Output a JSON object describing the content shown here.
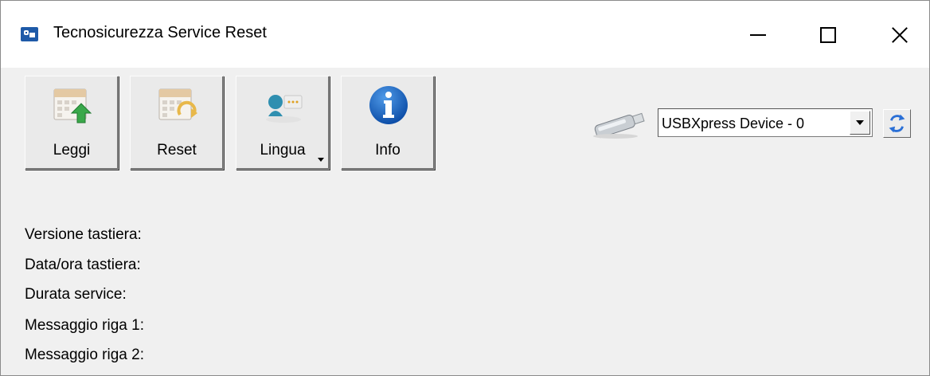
{
  "window": {
    "title": "Tecnosicurezza Service Reset",
    "controls": {
      "minimize": "—",
      "maximize": "☐",
      "close": "✕"
    }
  },
  "toolbar": {
    "buttons": [
      {
        "label": "Leggi",
        "icon": "calendar-upload-icon"
      },
      {
        "label": "Reset",
        "icon": "calendar-refresh-icon"
      },
      {
        "label": "Lingua",
        "icon": "language-speech-icon",
        "has_dropdown": true
      },
      {
        "label": "Info",
        "icon": "info-icon"
      }
    ]
  },
  "device": {
    "icon": "usb-drive-icon",
    "selected": "USBXpress Device - 0",
    "refresh_icon": "refresh-icon"
  },
  "info_fields": [
    {
      "label": "Versione tastiera:"
    },
    {
      "label": "Data/ora tastiera:"
    },
    {
      "label": "Durata service:"
    },
    {
      "label": "Messaggio riga 1:"
    },
    {
      "label": "Messaggio riga 2:"
    }
  ],
  "colors": {
    "accent": "#1e5aa8",
    "green_arrow": "#3aa84a",
    "info_blue": "#1565c0"
  }
}
